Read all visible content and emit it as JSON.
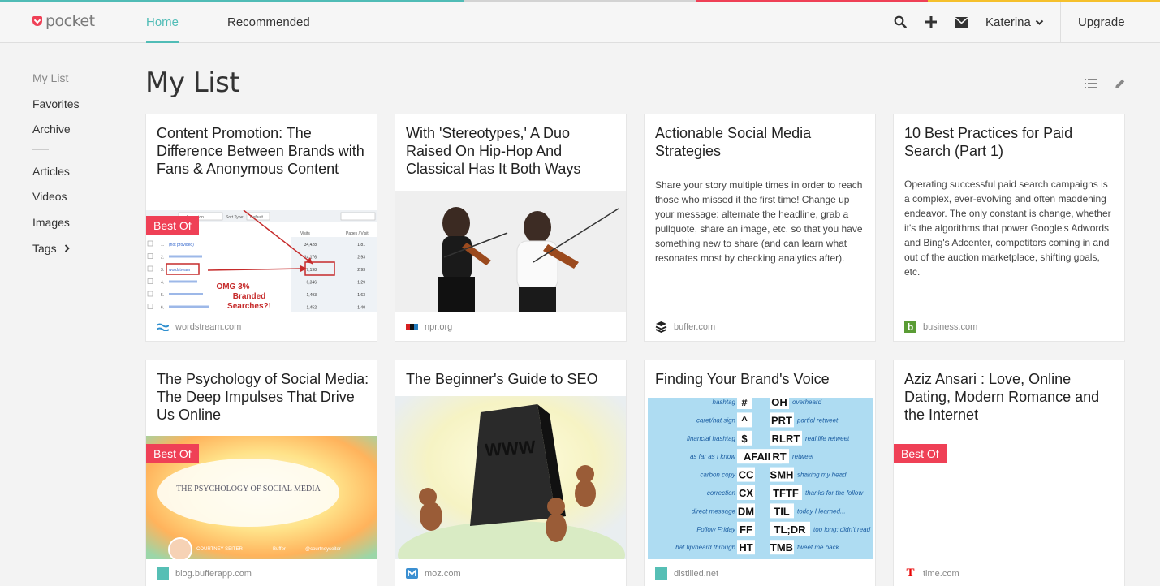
{
  "brand": {
    "name": "pocket",
    "accent": "#50bcb6",
    "logo_red": "#ef4056"
  },
  "nav": {
    "home": "Home",
    "recommended": "Recommended"
  },
  "header": {
    "user": "Katerina",
    "upgrade": "Upgrade",
    "icons": [
      "search-icon",
      "add-icon",
      "mail-icon"
    ]
  },
  "sidebar": {
    "items": [
      "My List",
      "Favorites",
      "Archive",
      "Articles",
      "Videos",
      "Images",
      "Tags"
    ]
  },
  "page": {
    "title": "My List"
  },
  "badge_label": "Best Of",
  "cards": [
    {
      "title": "Content Promotion: The Difference Between Brands with Fans & Anonymous Content",
      "source": "wordstream.com",
      "badge": true,
      "image": "analytics-table"
    },
    {
      "title": "With 'Stereotypes,' A Duo Raised On Hip-Hop And Classical Has It Both Ways",
      "source": "npr.org",
      "badge": false,
      "image": "violinists"
    },
    {
      "title": "Actionable Social Media Strategies",
      "source": "buffer.com",
      "badge": false,
      "excerpt": "Share your story multiple times in order to reach those who missed it the first time! Change up your message: alternate the headline, grab a pullquote, share an image, etc. so that you have something new to share (and can learn what resonates most by checking analytics after)."
    },
    {
      "title": "10 Best Practices for Paid Search (Part 1)",
      "source": "business.com",
      "badge": false,
      "excerpt": "Operating successful paid search campaigns is a complex, ever-evolving and often maddening endeavor.  The only constant is change, whether it's the algorithms that power Google's Adwords and Bing's Adcenter, competitors coming in and out of the auction marketplace, shifting goals, etc."
    },
    {
      "title": "The Psychology of Social Media: The Deep Impulses That Drive Us Online",
      "source": "blog.bufferapp.com",
      "badge": true,
      "image": "psychology-banner"
    },
    {
      "title": "The Beginner's Guide to SEO",
      "source": "moz.com",
      "badge": false,
      "image": "www-monolith"
    },
    {
      "title": "Finding Your Brand's Voice",
      "source": "distilled.net",
      "badge": false,
      "image": "acronyms"
    },
    {
      "title": "Aziz Ansari : Love, Online Dating, Modern Romance and the Internet",
      "source": "time.com",
      "badge": true
    }
  ],
  "image_text": {
    "analytics": {
      "filter_left": "e dimension",
      "filter_mid": "Sort Type:",
      "filter_right": "Default",
      "col_visits": "Visits",
      "col_pages": "Pages / Visit",
      "row1": "(not provided)",
      "rows_visits": [
        "34,428",
        "14,176",
        "7,198",
        "6,346",
        "1,493",
        "1,452"
      ],
      "rows_pages": [
        "1.81",
        "2.93",
        "2.93",
        "1.29",
        "1.63",
        "1.40"
      ],
      "highlight": "wordstream",
      "callout": "OMG 3% Branded Searches?!"
    },
    "psychology": {
      "heading": "THE PSYCHOLOGY OF SOCIAL MEDIA",
      "author": "COURTNEY SEITER",
      "brand": "Buffer",
      "handle": "@courtneyseiter"
    },
    "www": "WWW",
    "acronyms": [
      {
        "left": "hashtag",
        "symbol": "#",
        "code": "OH",
        "meaning": "overheard"
      },
      {
        "left": "caret/hat sign",
        "symbol": "^",
        "code": "PRT",
        "meaning": "partial retweet"
      },
      {
        "left": "financial hashtag",
        "symbol": "$",
        "code": "RLRT",
        "meaning": "real life retweet"
      },
      {
        "left": "as far as I know",
        "symbol": "AFAIK",
        "code": "RT",
        "meaning": "retweet"
      },
      {
        "left": "carbon copy",
        "symbol": "CC",
        "code": "SMH",
        "meaning": "shaking my head"
      },
      {
        "left": "correction",
        "symbol": "CX",
        "code": "TFTF",
        "meaning": "thanks for the follow"
      },
      {
        "left": "direct message",
        "symbol": "DM",
        "code": "TIL",
        "meaning": "today I learned..."
      },
      {
        "left": "Follow Friday",
        "symbol": "FF",
        "code": "TL;DR",
        "meaning": "too long; didn't read"
      },
      {
        "left": "hat tip/heard through",
        "symbol": "HT",
        "code": "TMB",
        "meaning": "tweet me back"
      }
    ]
  }
}
